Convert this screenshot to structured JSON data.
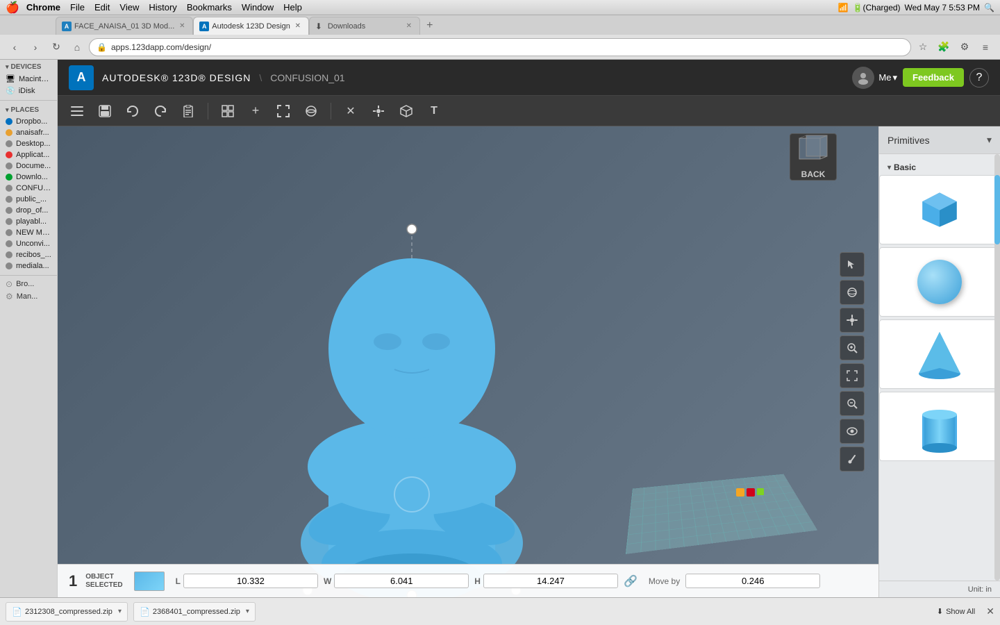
{
  "menubar": {
    "apple": "🍎",
    "items": [
      "Chrome",
      "File",
      "Edit",
      "View",
      "History",
      "Bookmarks",
      "Window",
      "Help"
    ],
    "right_time": "Wed May 7  5:53 PM",
    "battery": "Charged"
  },
  "tabs": [
    {
      "id": "tab1",
      "title": "FACE_ANAISA_01 3D Mod...",
      "active": false,
      "favicon": "A"
    },
    {
      "id": "tab2",
      "title": "Autodesk 123D Design",
      "active": true,
      "favicon": "A"
    },
    {
      "id": "tab3",
      "title": "Downloads",
      "active": false,
      "favicon": "⬇"
    }
  ],
  "address_bar": {
    "url": "apps.123dapp.com/design/"
  },
  "app_header": {
    "logo": "A",
    "title": "AUTODESK® 123D® DESIGN",
    "separator": "\\",
    "project": "CONFUSION_01",
    "user": "Me",
    "feedback_label": "Feedback",
    "help_label": "?"
  },
  "toolbar": {
    "buttons": [
      {
        "name": "menu-icon",
        "icon": "☰",
        "label": "Menu"
      },
      {
        "name": "save-icon",
        "icon": "💾",
        "label": "Save"
      },
      {
        "name": "undo-icon",
        "icon": "↩",
        "label": "Undo"
      },
      {
        "name": "redo-icon",
        "icon": "↪",
        "label": "Redo"
      },
      {
        "name": "clipboard-icon",
        "icon": "📋",
        "label": "Clipboard"
      },
      {
        "name": "snap-icon",
        "icon": "⊞",
        "label": "Snap"
      },
      {
        "name": "add-icon",
        "icon": "+",
        "label": "Add"
      },
      {
        "name": "fit-icon",
        "icon": "⤢",
        "label": "Fit"
      },
      {
        "name": "refresh-icon",
        "icon": "↺",
        "label": "Refresh"
      },
      {
        "name": "transform-icon",
        "icon": "✕",
        "label": "Transform"
      },
      {
        "name": "manipulator-icon",
        "icon": "⊕",
        "label": "Manipulator"
      },
      {
        "name": "view-icon",
        "icon": "◼",
        "label": "View"
      },
      {
        "name": "text-icon",
        "icon": "T",
        "label": "Text"
      }
    ]
  },
  "view_controls": [
    {
      "name": "select-tool",
      "icon": "↖"
    },
    {
      "name": "orbit-tool",
      "icon": "⊙"
    },
    {
      "name": "pan-tool",
      "icon": "✋"
    },
    {
      "name": "zoom-tool",
      "icon": "🔍"
    },
    {
      "name": "fit-view-tool",
      "icon": "⊞"
    },
    {
      "name": "zoom-window-tool",
      "icon": "⊕"
    },
    {
      "name": "visibility-tool",
      "icon": "👁"
    },
    {
      "name": "measure-tool",
      "icon": "📐"
    }
  ],
  "back_view": {
    "label": "BACK"
  },
  "dimension_bar": {
    "obj_count": "1",
    "obj_label_line1": "OBJECT",
    "obj_label_line2": "SELECTED",
    "length_label": "L",
    "length_value": "10.332",
    "width_label": "W",
    "width_value": "6.041",
    "height_label": "H",
    "height_value": "14.247",
    "move_label": "Move by",
    "move_value": "0.246"
  },
  "right_panel": {
    "title": "Primitives",
    "section_basic": "Basic",
    "unit_label": "Unit:  in",
    "primitives": [
      {
        "name": "cube",
        "shape": "cube"
      },
      {
        "name": "sphere",
        "shape": "sphere"
      },
      {
        "name": "cone",
        "shape": "cone"
      },
      {
        "name": "cylinder",
        "shape": "cylinder"
      }
    ]
  },
  "sidebar": {
    "devices_label": "DEVICES",
    "places_label": "PLACES",
    "devices": [
      {
        "name": "Macinto...",
        "icon": "🖥",
        "color": "#888"
      },
      {
        "name": "iDisk",
        "icon": "💿",
        "color": "#888"
      }
    ],
    "places": [
      {
        "name": "Dropbo...",
        "color": "#0070c0",
        "icon": "folder"
      },
      {
        "name": "anaisafr...",
        "color": "#e8a030",
        "icon": "folder"
      },
      {
        "name": "Desktop...",
        "color": "#888",
        "icon": "folder"
      },
      {
        "name": "Applicat...",
        "color": "#e83030",
        "icon": "folder"
      },
      {
        "name": "Docume...",
        "color": "#888",
        "icon": "folder"
      },
      {
        "name": "Downlo...",
        "color": "#00a030",
        "icon": "folder"
      },
      {
        "name": "CONFUS...",
        "color": "#888",
        "icon": "folder"
      },
      {
        "name": "public_...",
        "color": "#888",
        "icon": "folder"
      },
      {
        "name": "drop_of...",
        "color": "#888",
        "icon": "folder"
      },
      {
        "name": "playabl...",
        "color": "#888",
        "icon": "folder"
      },
      {
        "name": "NEW MA...",
        "color": "#888",
        "icon": "folder"
      },
      {
        "name": "Unconvi...",
        "color": "#888",
        "icon": "folder"
      },
      {
        "name": "recibos_...",
        "color": "#888",
        "icon": "folder"
      },
      {
        "name": "mediala...",
        "color": "#888",
        "icon": "folder"
      }
    ],
    "actions": [
      {
        "name": "Browse...",
        "icon": "⊙"
      },
      {
        "name": "Man...",
        "icon": "⚙"
      }
    ]
  },
  "downloads": [
    {
      "filename": "2312308_compressed.zip"
    },
    {
      "filename": "2368401_compressed.zip"
    }
  ],
  "download_bar": {
    "show_all_label": "Show All",
    "close_icon": "✕"
  }
}
